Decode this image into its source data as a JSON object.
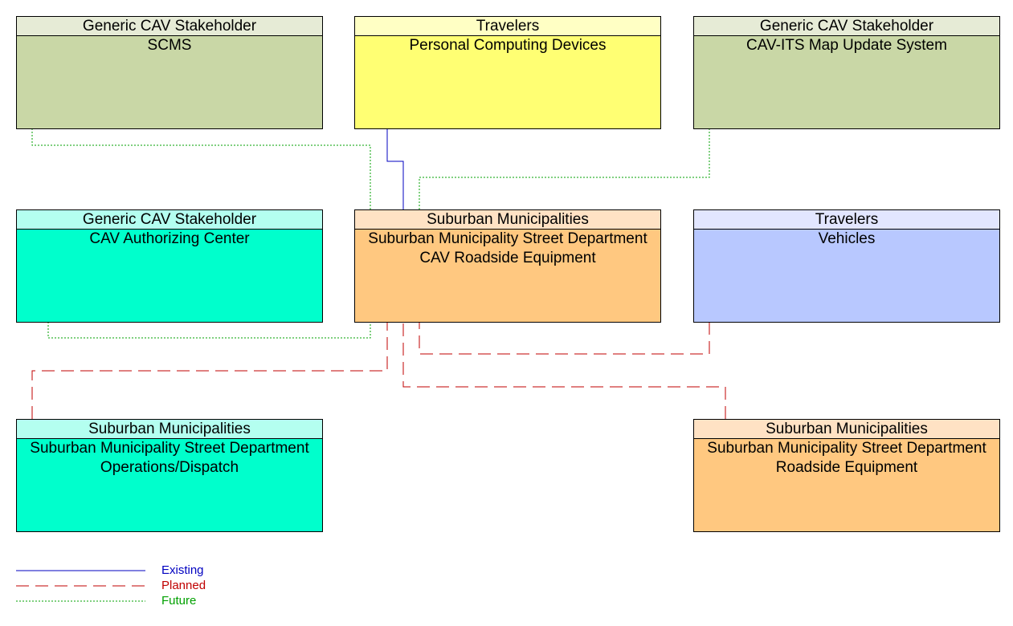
{
  "elements": [
    {
      "id": "scms",
      "stakeholder": "Generic CAV Stakeholder",
      "name": "SCMS",
      "hdr": "#e6ebd6",
      "fill": "#c9d7a6"
    },
    {
      "id": "pcd",
      "stakeholder": "Travelers",
      "name": "Personal Computing Devices",
      "hdr": "#ffffc4",
      "fill": "#ffff73"
    },
    {
      "id": "map",
      "stakeholder": "Generic CAV Stakeholder",
      "name": "CAV-ITS Map Update System",
      "hdr": "#e6ebd6",
      "fill": "#c9d7a6"
    },
    {
      "id": "auth",
      "stakeholder": "Generic CAV Stakeholder",
      "name": "CAV Authorizing Center",
      "hdr": "#b4fff0",
      "fill": "#00ffcc"
    },
    {
      "id": "cavrse",
      "stakeholder": "Suburban Municipalities",
      "name": "Suburban Municipality Street Department CAV Roadside Equipment",
      "hdr": "#ffe2c4",
      "fill": "#ffc880"
    },
    {
      "id": "veh",
      "stakeholder": "Travelers",
      "name": "Vehicles",
      "hdr": "#e2e6ff",
      "fill": "#b8c8ff"
    },
    {
      "id": "ops",
      "stakeholder": "Suburban Municipalities",
      "name": "Suburban Municipality Street Department Operations/Dispatch",
      "hdr": "#b4fff0",
      "fill": "#00ffcc"
    },
    {
      "id": "rse",
      "stakeholder": "Suburban Municipalities",
      "name": "Suburban Municipality Street Department Roadside Equipment",
      "hdr": "#ffe2c4",
      "fill": "#ffc880"
    }
  ],
  "connections": [
    {
      "from": "scms",
      "to": "cavrse",
      "status": "future"
    },
    {
      "from": "pcd",
      "to": "cavrse",
      "status": "existing"
    },
    {
      "from": "map",
      "to": "cavrse",
      "status": "future"
    },
    {
      "from": "auth",
      "to": "cavrse",
      "status": "future"
    },
    {
      "from": "veh",
      "to": "cavrse",
      "status": "planned"
    },
    {
      "from": "ops",
      "to": "cavrse",
      "status": "planned"
    },
    {
      "from": "rse",
      "to": "cavrse",
      "status": "planned"
    }
  ],
  "legend": {
    "existing": "Existing",
    "planned": "Planned",
    "future": "Future"
  },
  "colors": {
    "existing": "#0000c0",
    "planned": "#c00000",
    "future": "#00a000"
  }
}
